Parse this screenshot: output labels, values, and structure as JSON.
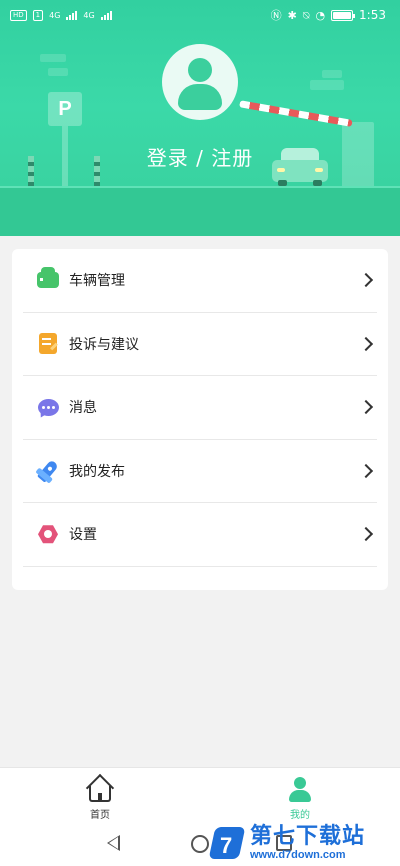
{
  "status_bar": {
    "left_badges": [
      "HD",
      "1"
    ],
    "network_a": "4G",
    "network_b": "4G",
    "time": "1:53"
  },
  "header": {
    "parking_sign": "P",
    "login_label": "登录 / 注册"
  },
  "menu": {
    "items": [
      {
        "label": "车辆管理",
        "icon": "car-icon"
      },
      {
        "label": "投诉与建议",
        "icon": "note-icon"
      },
      {
        "label": "消息",
        "icon": "message-icon"
      },
      {
        "label": "我的发布",
        "icon": "rocket-icon"
      },
      {
        "label": "设置",
        "icon": "settings-icon"
      }
    ]
  },
  "bottom_nav": {
    "tabs": [
      {
        "label": "首页",
        "icon": "home-icon",
        "active": false
      },
      {
        "label": "我的",
        "icon": "person-icon",
        "active": true
      }
    ]
  },
  "watermark": {
    "logo_char": "7",
    "title": "第七下载站",
    "url": "www.d7down.com"
  },
  "colors": {
    "accent": "#39c995",
    "header_green": "#36d4a2"
  }
}
